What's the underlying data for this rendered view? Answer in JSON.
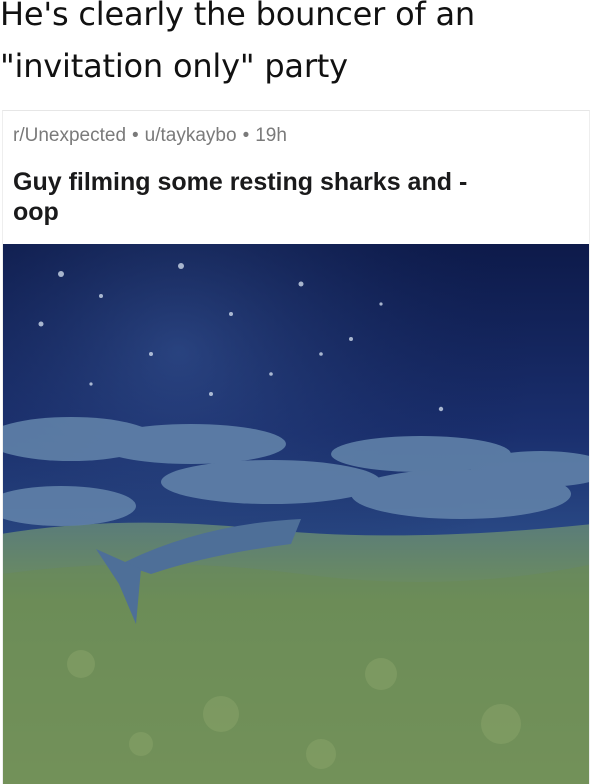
{
  "caption": {
    "line1": "He's clearly the bouncer of an",
    "line2": "\"invitation only\" party"
  },
  "post": {
    "subreddit": "r/Unexpected",
    "separator": "•",
    "user": "u/taykaybo",
    "age": "19h",
    "title": "Guy filming some resting sharks and -\noop"
  },
  "colors": {
    "water_deep": "#0d1a4a",
    "water_mid": "#1f3c80",
    "shark": "#5c7fa6",
    "seabed": "#6f8f5a"
  }
}
